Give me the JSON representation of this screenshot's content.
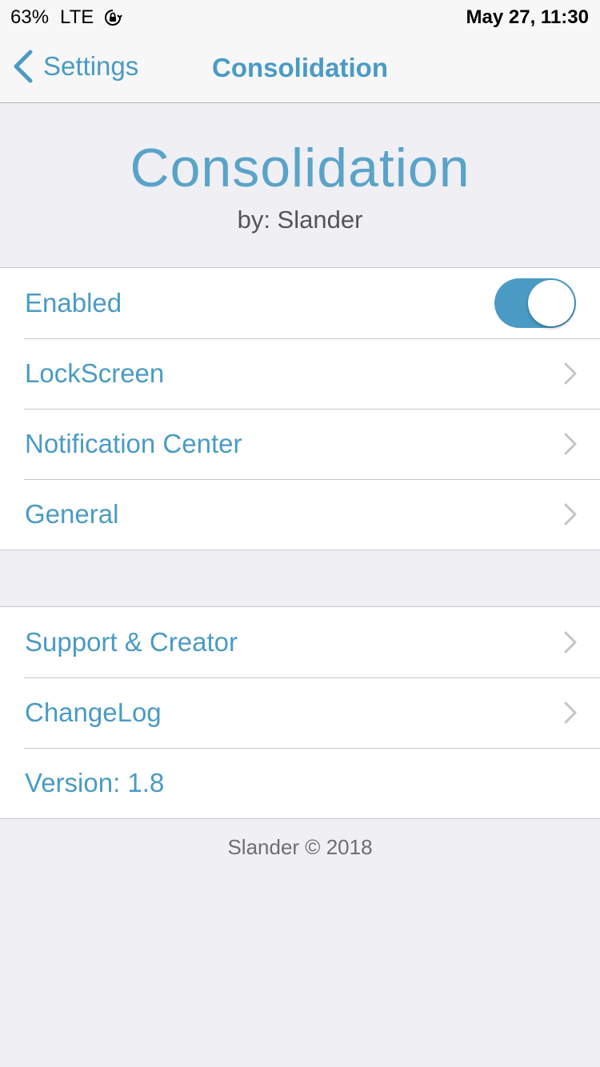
{
  "status_bar": {
    "battery": "63%",
    "carrier": "LTE",
    "datetime": "May 27, 11:30"
  },
  "nav": {
    "back_label": "Settings",
    "title": "Consolidation"
  },
  "header": {
    "title": "Consolidation",
    "subtitle": "by: Slander"
  },
  "group1": {
    "enabled_label": "Enabled",
    "enabled_value": true,
    "items": [
      {
        "label": "LockScreen"
      },
      {
        "label": "Notification Center"
      },
      {
        "label": "General"
      }
    ]
  },
  "group2": {
    "items": [
      {
        "label": "Support & Creator"
      },
      {
        "label": "ChangeLog"
      }
    ],
    "version_label": "Version: 1.8"
  },
  "footer": "Slander © 2018",
  "colors": {
    "accent": "#4a9bc4",
    "background": "#efeff4",
    "toggle_on": "#4a9bc4"
  },
  "icons": {
    "back": "chevron-left-icon",
    "disclosure": "chevron-right-icon",
    "orientation_lock": "orientation-lock-icon"
  }
}
